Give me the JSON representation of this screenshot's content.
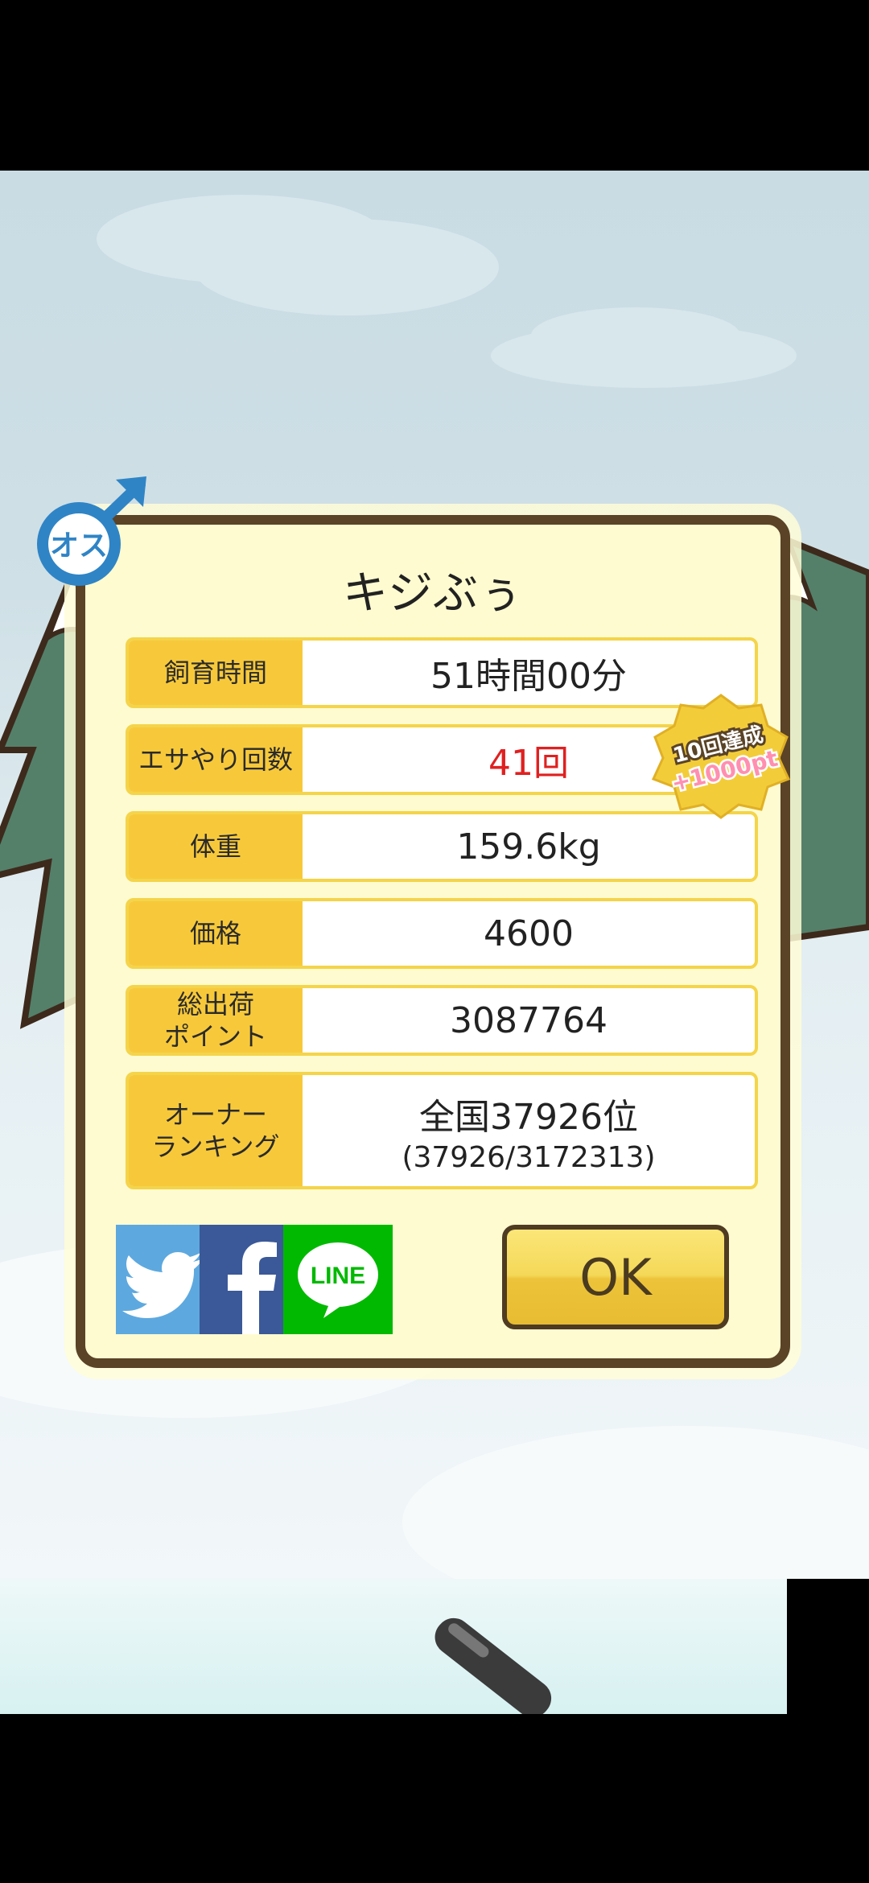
{
  "dialog": {
    "title": "キジぶぅ",
    "rows": [
      {
        "label": "飼育時間",
        "value": "51時間00分"
      },
      {
        "label": "エサやり回数",
        "value": "41回"
      },
      {
        "label": "体重",
        "value": "159.6kg"
      },
      {
        "label": "価格",
        "value": "4600"
      },
      {
        "label_line1": "総出荷",
        "label_line2": "ポイント",
        "value": "3087764"
      },
      {
        "label_line1": "オーナー",
        "label_line2": "ランキング",
        "value": "全国37926位",
        "value_sub": "(37926/3172313)"
      }
    ],
    "ok_label": "OK"
  },
  "gender_badge": {
    "text": "オス",
    "icon": "male-symbol-icon"
  },
  "achievement_badge": {
    "line1": "10回達成",
    "line2": "+1000pt"
  },
  "social": {
    "twitter": {
      "icon": "twitter-bird-icon",
      "color": "#5da9df"
    },
    "facebook": {
      "icon": "facebook-f-icon",
      "color": "#3b5998"
    },
    "line": {
      "icon": "line-icon",
      "text": "LINE",
      "color": "#00b900"
    }
  },
  "colors": {
    "frame": "#5a4326",
    "panel": "#fffbd0",
    "label_bg": "#f7c93a",
    "accent_red": "#e02020"
  }
}
